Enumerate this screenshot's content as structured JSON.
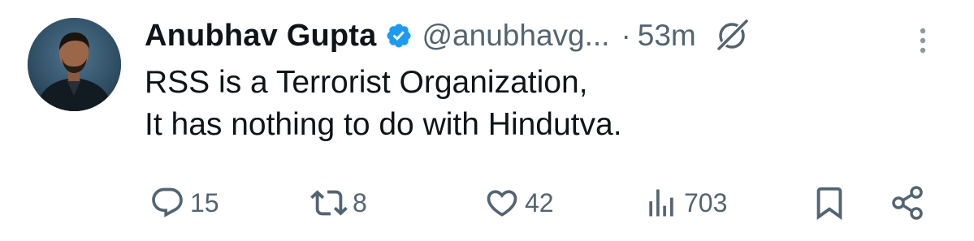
{
  "tweet": {
    "author": {
      "display_name": "Anubhav Gupta",
      "handle": "@anubhavg...",
      "verified": true
    },
    "separator": "·",
    "timestamp": "53m",
    "text_lines": [
      "RSS is a Terrorist Organization,",
      "It has nothing to do with Hindutva."
    ],
    "actions": {
      "replies": "15",
      "reposts": "8",
      "likes": "42",
      "views": "703"
    }
  },
  "colors": {
    "text_primary": "#0f1419",
    "text_secondary": "#536471",
    "verified_badge": "#1d9bf0"
  },
  "icons": {
    "verified": "verified-badge-icon",
    "grok": "grok-icon",
    "more": "more-vertical-icon",
    "reply": "reply-icon",
    "repost": "repost-icon",
    "like": "heart-icon",
    "views": "analytics-icon",
    "bookmark": "bookmark-icon",
    "share": "share-icon"
  }
}
